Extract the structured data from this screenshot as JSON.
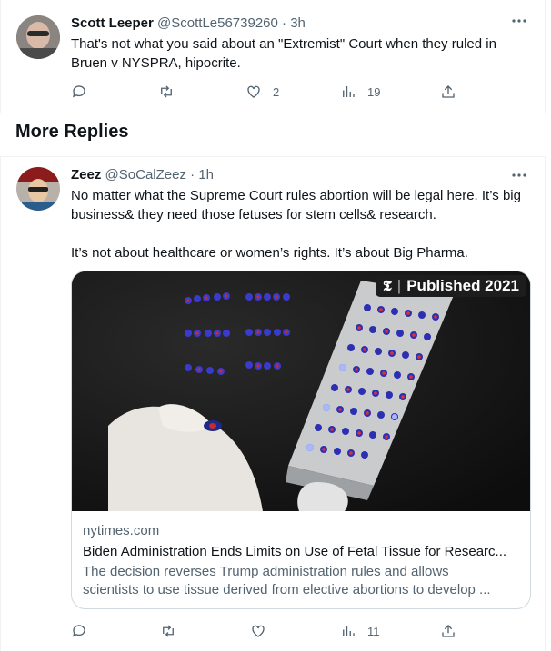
{
  "reply1": {
    "name": "Scott Leeper",
    "handle": "@ScottLe56739260",
    "dot": "·",
    "time": "3h",
    "text": "That's not what you said about an \"Extremist\" Court when they ruled in Bruen v NYSPRA, hipocrite.",
    "likes": "2",
    "views": "19"
  },
  "section": {
    "title": "More Replies"
  },
  "reply2": {
    "name": "Zeez",
    "handle": "@SoCalZeez",
    "dot": "·",
    "time": "1h",
    "text_p1": "No matter what the Supreme Court rules abortion will be legal here. It’s big business& they need those fetuses for stem cells& research.",
    "text_p2": "It’s not about healthcare or women’s rights. It’s about Big Pharma.",
    "views": "11",
    "card": {
      "badge_logo": "𝕿",
      "badge_sep": "|",
      "badge_text": "Published 2021",
      "domain": "nytimes.com",
      "title": "Biden Administration Ends Limits on Use of Fetal Tissue for Researc...",
      "desc_line1": "The decision reverses Trump administration rules and allows",
      "desc_line2": "scientists to use tissue derived from elective abortions to develop ..."
    }
  },
  "icons": {
    "more": "more-horizontal-icon",
    "reply": "reply-icon",
    "retweet": "retweet-icon",
    "like": "like-icon",
    "views": "views-icon",
    "share": "share-icon"
  },
  "colors": {
    "muted": "#536471",
    "text": "#0f1419",
    "border": "#eff3f4"
  }
}
